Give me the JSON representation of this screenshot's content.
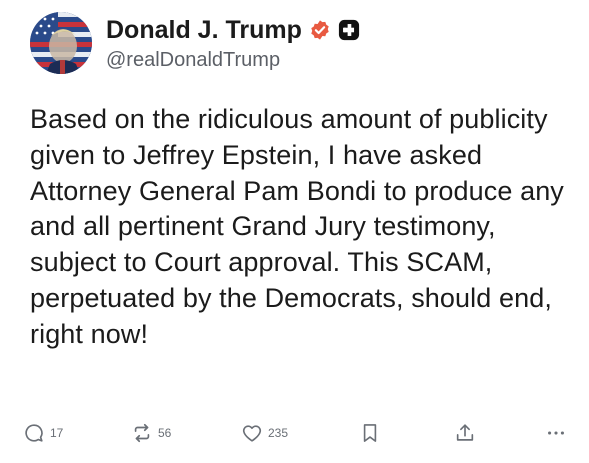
{
  "author": {
    "display_name": "Donald J. Trump",
    "handle": "@realDonaldTrump",
    "avatar_icon": "flag-portrait-avatar",
    "verified_icon": "verified-badge-icon",
    "verified_color": "#e85a41",
    "badge_icon": "truth-social-badge-icon"
  },
  "post": {
    "text": "Based on the ridiculous amount of publicity given to Jeffrey Epstein, I have asked Attorney General Pam Bondi to produce any and all pertinent Grand Jury testimony, subject to Court approval. This SCAM, perpetuated by the Democrats, should end, right now!"
  },
  "actions": {
    "replies": {
      "icon": "reply-icon",
      "count": "17"
    },
    "retruths": {
      "icon": "retruth-icon",
      "count": "56"
    },
    "likes": {
      "icon": "heart-icon",
      "count": "235"
    },
    "bookmark": {
      "icon": "bookmark-icon"
    },
    "share": {
      "icon": "share-icon"
    },
    "more": {
      "icon": "more-icon"
    }
  }
}
